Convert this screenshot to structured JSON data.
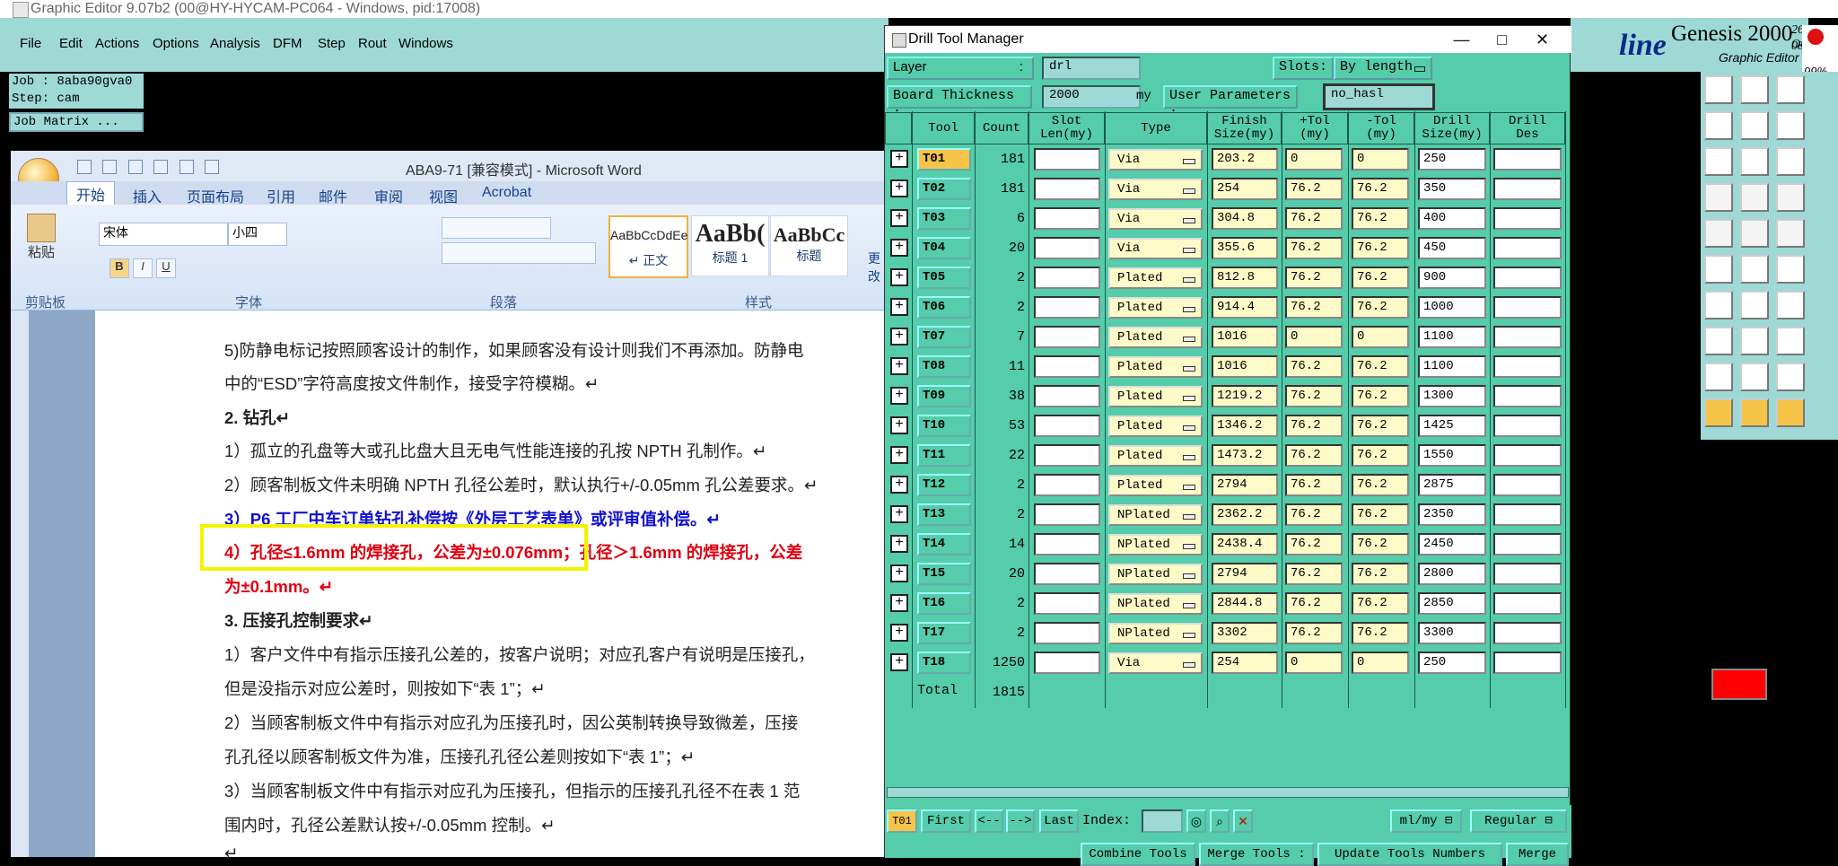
{
  "genesis": {
    "title": "Graphic Editor 9.07b2 (00@HY-HYCAM-PC064 - Windows, pid:17008)",
    "menu": [
      "File",
      "Edit",
      "Actions",
      "Options",
      "Analysis",
      "DFM",
      "Step",
      "Rout",
      "Windows"
    ],
    "job": "Job : 8aba90gva0",
    "step": "Step: cam",
    "job_matrix": "Job Matrix ...",
    "logo_title": "Genesis 2000",
    "logo_sub": "Graphic Editor",
    "logo_date": "26 Oc",
    "logo_time": "08:",
    "brand_fragment": "line",
    "percent": "99%"
  },
  "word": {
    "doc_title": "ABA9-71 [兼容模式] - Microsoft Word",
    "tabs": [
      "开始",
      "插入",
      "页面布局",
      "引用",
      "邮件",
      "审阅",
      "视图",
      "Acrobat"
    ],
    "font_name": "宋体",
    "font_size": "小四",
    "paste": "粘贴",
    "groups": [
      "剪贴板",
      "字体",
      "段落",
      "样式"
    ],
    "styles": [
      {
        "preview": "AaBbCcDdEe",
        "name": "↵ 正文"
      },
      {
        "preview": "AaBb(",
        "name": "标题 1"
      },
      {
        "preview": "AaBbCc",
        "name": "标题"
      }
    ],
    "more_styles": "更改",
    "paragraphs": [
      {
        "text": "5)防静电标记按照顾客设计的制作，如果顾客没有设计则我们不再添加。防静电",
        "style": "normal"
      },
      {
        "text": "中的“ESD”字符高度按文件制作，接受字符模糊。↵",
        "style": "normal"
      },
      {
        "text": "2. 钻孔↵",
        "style": "bold"
      },
      {
        "text": "1）孤立的孔盘等大或孔比盘大且无电气性能连接的孔按 NPTH 孔制作。↵",
        "style": "normal"
      },
      {
        "text": "2）顾客制板文件未明确 NPTH 孔径公差时，默认执行+/-0.05mm 孔公差要求。↵",
        "style": "normal"
      },
      {
        "text": "3）P6 工厂中车订单钻孔补偿按《外层工艺表单》或评审值补偿。↵",
        "style": "blue"
      },
      {
        "text": "4）孔径≤1.6mm 的焊接孔，公差为±0.076mm；孔径＞1.6mm 的焊接孔，公差",
        "style": "red"
      },
      {
        "text": "为±0.1mm。↵",
        "style": "red"
      },
      {
        "text": "3. 压接孔控制要求↵",
        "style": "bold"
      },
      {
        "text": "1）客户文件中有指示压接孔公差的，按客户说明；对应孔客户有说明是压接孔，",
        "style": "normal"
      },
      {
        "text": "但是没指示对应公差时，则按如下“表 1”；↵",
        "style": "normal"
      },
      {
        "text": "2）当顾客制板文件中有指示对应孔为压接孔时，因公英制转换导致微差，压接",
        "style": "normal"
      },
      {
        "text": "孔孔径以顾客制板文件为准，压接孔孔径公差则按如下“表 1”；↵",
        "style": "normal"
      },
      {
        "text": "3）当顾客制板文件中有指示对应孔为压接孔，但指示的压接孔孔径不在表 1 范",
        "style": "normal"
      },
      {
        "text": "围内时，孔径公差默认按+/-0.05mm 控制。↵",
        "style": "normal"
      },
      {
        "text": "↵",
        "style": "normal"
      }
    ]
  },
  "dtm": {
    "title": "Drill Tool Manager",
    "layer_label": "Layer",
    "layer_value": "drl",
    "slots_label": "Slots:",
    "slots_value": "By length",
    "thickness_label": "Board Thickness :",
    "thickness_value": "2000",
    "thickness_unit": "my",
    "user_params_label": "User Parameters :",
    "user_params_value": "no_hasl",
    "headers": [
      "Tool",
      "Count",
      "Slot\nLen(my)",
      "Type",
      "Finish\nSize(my)",
      "+Tol\n(my)",
      "-Tol\n(my)",
      "Drill\nSize(my)",
      "Drill\nDes"
    ],
    "rows": [
      {
        "tool": "T01",
        "count": "181",
        "type": "Via",
        "finish": "203.2",
        "ptol": "0",
        "ntol": "0",
        "drill": "250"
      },
      {
        "tool": "T02",
        "count": "181",
        "type": "Via",
        "finish": "254",
        "ptol": "76.2",
        "ntol": "76.2",
        "drill": "350"
      },
      {
        "tool": "T03",
        "count": "6",
        "type": "Via",
        "finish": "304.8",
        "ptol": "76.2",
        "ntol": "76.2",
        "drill": "400"
      },
      {
        "tool": "T04",
        "count": "20",
        "type": "Via",
        "finish": "355.6",
        "ptol": "76.2",
        "ntol": "76.2",
        "drill": "450"
      },
      {
        "tool": "T05",
        "count": "2",
        "type": "Plated",
        "finish": "812.8",
        "ptol": "76.2",
        "ntol": "76.2",
        "drill": "900"
      },
      {
        "tool": "T06",
        "count": "2",
        "type": "Plated",
        "finish": "914.4",
        "ptol": "76.2",
        "ntol": "76.2",
        "drill": "1000"
      },
      {
        "tool": "T07",
        "count": "7",
        "type": "Plated",
        "finish": "1016",
        "ptol": "0",
        "ntol": "0",
        "drill": "1100"
      },
      {
        "tool": "T08",
        "count": "11",
        "type": "Plated",
        "finish": "1016",
        "ptol": "76.2",
        "ntol": "76.2",
        "drill": "1100"
      },
      {
        "tool": "T09",
        "count": "38",
        "type": "Plated",
        "finish": "1219.2",
        "ptol": "76.2",
        "ntol": "76.2",
        "drill": "1300"
      },
      {
        "tool": "T10",
        "count": "53",
        "type": "Plated",
        "finish": "1346.2",
        "ptol": "76.2",
        "ntol": "76.2",
        "drill": "1425"
      },
      {
        "tool": "T11",
        "count": "22",
        "type": "Plated",
        "finish": "1473.2",
        "ptol": "76.2",
        "ntol": "76.2",
        "drill": "1550"
      },
      {
        "tool": "T12",
        "count": "2",
        "type": "Plated",
        "finish": "2794",
        "ptol": "76.2",
        "ntol": "76.2",
        "drill": "2875"
      },
      {
        "tool": "T13",
        "count": "2",
        "type": "NPlated",
        "finish": "2362.2",
        "ptol": "76.2",
        "ntol": "76.2",
        "drill": "2350"
      },
      {
        "tool": "T14",
        "count": "14",
        "type": "NPlated",
        "finish": "2438.4",
        "ptol": "76.2",
        "ntol": "76.2",
        "drill": "2450"
      },
      {
        "tool": "T15",
        "count": "20",
        "type": "NPlated",
        "finish": "2794",
        "ptol": "76.2",
        "ntol": "76.2",
        "drill": "2800"
      },
      {
        "tool": "T16",
        "count": "2",
        "type": "NPlated",
        "finish": "2844.8",
        "ptol": "76.2",
        "ntol": "76.2",
        "drill": "2850"
      },
      {
        "tool": "T17",
        "count": "2",
        "type": "NPlated",
        "finish": "3302",
        "ptol": "76.2",
        "ntol": "76.2",
        "drill": "3300"
      },
      {
        "tool": "T18",
        "count": "1250",
        "type": "Via",
        "finish": "254",
        "ptol": "0",
        "ntol": "0",
        "drill": "250"
      }
    ],
    "total_label": "Total",
    "total_count": "1815",
    "nav": {
      "current": "T01",
      "first": "First",
      "prev": "<--",
      "next": "-->",
      "last": "Last",
      "index_label": "Index:",
      "unit": "ml/my",
      "mode": "Regular"
    },
    "actions": [
      "Combine Tools",
      "Merge Tools :",
      "Update Tools Numbers",
      "Merge"
    ]
  }
}
